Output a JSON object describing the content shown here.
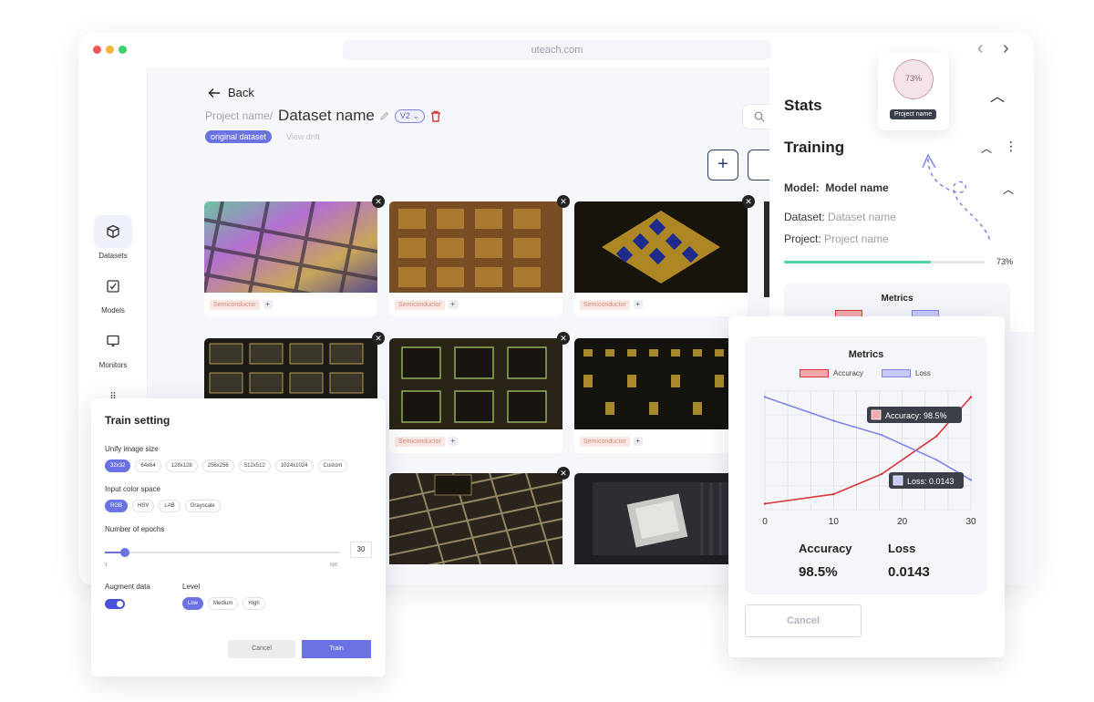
{
  "window": {
    "url": "uteach.com"
  },
  "sidebar": {
    "items": [
      {
        "label": "Datasets"
      },
      {
        "label": "Models"
      },
      {
        "label": "Monitors"
      }
    ]
  },
  "header": {
    "back_label": "Back",
    "project": "Project name/",
    "dataset_name": "Dataset name",
    "version": "V2",
    "original_tag": "original dataset",
    "view_drift": "View drift"
  },
  "cards": {
    "tag": "Semiconductor"
  },
  "stats": {
    "title": "Stats",
    "training_title": "Training",
    "model_label": "Model:",
    "model_name": "Model name",
    "dataset_label": "Dataset:",
    "dataset_value": "Dataset name",
    "project_label": "Project:",
    "project_value": "Project name",
    "progress_text": "73%",
    "progress": 0.73,
    "bg_metrics_title": "Metrics"
  },
  "project_card": {
    "percent": "73%",
    "tooltip": "Project name"
  },
  "train_setting": {
    "title": "Train setting",
    "image_size_label": "Unify image size",
    "image_sizes": [
      "32x32",
      "64x64",
      "128x128",
      "256x256",
      "512x512",
      "1024x1024",
      "Custom"
    ],
    "color_space_label": "Input color space",
    "color_spaces": [
      "RGB",
      "HSV",
      "LAB",
      "Grayscale"
    ],
    "epochs_label": "Number of epochs",
    "epochs": "30",
    "epochs_min": "1",
    "epochs_max": "500",
    "augment_label": "Augment data",
    "level_label": "Level",
    "levels": [
      "Low",
      "Medium",
      "High"
    ],
    "cancel_label": "Cancel",
    "train_label": "Train"
  },
  "metrics_modal": {
    "title": "Metrics",
    "legend_accuracy": "Accuracy",
    "legend_loss": "Loss",
    "accuracy_tip": "Accuracy: 98.5%",
    "loss_tip": "Loss: 0.0143",
    "accuracy_label": "Accuracy",
    "accuracy_value": "98.5%",
    "loss_label": "Loss",
    "loss_value": "0.0143",
    "cancel_label": "Cancel",
    "colors": {
      "accuracy": "#d8363a",
      "loss": "#7f86e6"
    }
  },
  "chart_data": {
    "type": "line",
    "title": "Metrics",
    "x": [
      0,
      10,
      17,
      25,
      30
    ],
    "xticks": [
      "0",
      "10",
      "20",
      "30"
    ],
    "xlim": [
      0,
      30
    ],
    "ylim": [
      0,
      1
    ],
    "series": [
      {
        "name": "Accuracy",
        "values": [
          0.05,
          0.13,
          0.3,
          0.62,
          0.95
        ]
      },
      {
        "name": "Loss",
        "values": [
          0.95,
          0.75,
          0.63,
          0.42,
          0.25
        ]
      }
    ],
    "grid": true,
    "legend": "top"
  }
}
